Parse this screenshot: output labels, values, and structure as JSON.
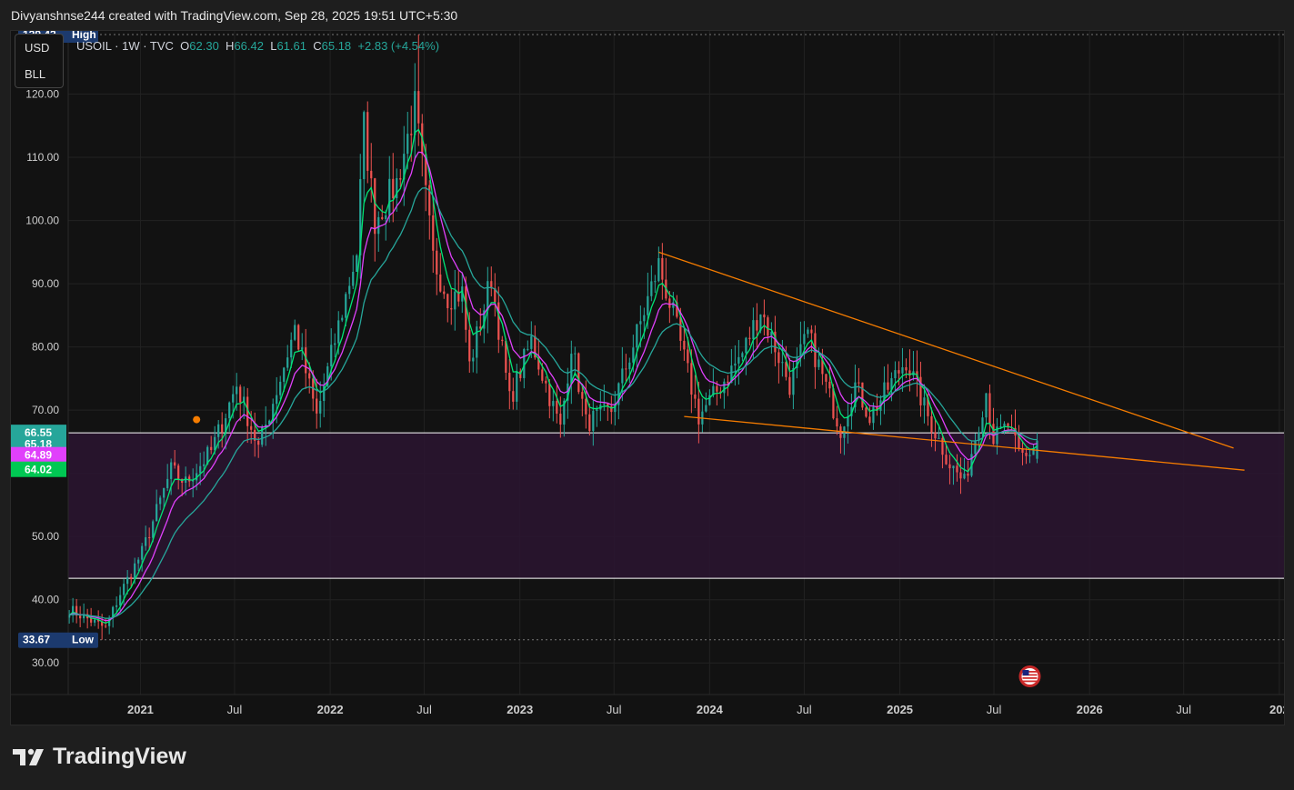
{
  "header": {
    "attribution": "Divyanshnse244 created with TradingView.com, Sep 28, 2025 19:51 UTC+5:30"
  },
  "unit_box": {
    "currency": "USD",
    "unit": "BLL"
  },
  "legend": {
    "symbol": "USOIL · 1W · TVC",
    "open_label": "O",
    "open": "62.30",
    "high_label": "H",
    "high": "66.42",
    "low_label": "L",
    "low": "61.61",
    "close_label": "C",
    "close": "65.18",
    "change": "+2.83 (+4.54%)"
  },
  "footer": {
    "brand": "TradingView",
    "logo_icon": "tradingview-logo-icon"
  },
  "colors": {
    "background": "#121212",
    "up": "#26a69a",
    "down": "#ef5350",
    "ma_fast": "#00e676",
    "ma_mid": "#e040fb",
    "ma_slow": "#26a69a",
    "trendline": "#f57c00",
    "zone": "#2a1530"
  },
  "chart_data": {
    "type": "candlestick",
    "timeframe": "1W",
    "symbol": "USOIL",
    "ylim": [
      25,
      130
    ],
    "xlim": [
      "2020-08-15",
      "2027-01-10"
    ],
    "y_ticks": [
      30,
      40,
      50,
      60,
      70,
      80,
      90,
      100,
      110,
      120
    ],
    "y_tick_labels": [
      "30.00",
      "40.00",
      "50.00",
      "60.00",
      "70.00",
      "80.00",
      "90.00",
      "100.00",
      "110.00",
      "120.00"
    ],
    "x_ticks": [
      {
        "date": "2021-01-01",
        "label": "2021",
        "bold": true
      },
      {
        "date": "2021-07-01",
        "label": "Jul",
        "bold": false
      },
      {
        "date": "2022-01-01",
        "label": "2022",
        "bold": true
      },
      {
        "date": "2022-07-01",
        "label": "Jul",
        "bold": false
      },
      {
        "date": "2023-01-01",
        "label": "2023",
        "bold": true
      },
      {
        "date": "2023-07-01",
        "label": "Jul",
        "bold": false
      },
      {
        "date": "2024-01-01",
        "label": "2024",
        "bold": true
      },
      {
        "date": "2024-07-01",
        "label": "Jul",
        "bold": false
      },
      {
        "date": "2025-01-01",
        "label": "2025",
        "bold": true
      },
      {
        "date": "2025-07-01",
        "label": "Jul",
        "bold": false
      },
      {
        "date": "2026-01-01",
        "label": "2026",
        "bold": true
      },
      {
        "date": "2026-07-01",
        "label": "Jul",
        "bold": false
      },
      {
        "date": "2027-01-01",
        "label": "202",
        "bold": true
      }
    ],
    "high_marker": {
      "value": 129.42,
      "label": "129.42",
      "tag": "High"
    },
    "low_marker": {
      "value": 33.67,
      "label": "33.67",
      "tag": "Low"
    },
    "price_tags": [
      {
        "value": 66.55,
        "label": "66.55",
        "color": "#26a69a"
      },
      {
        "value": 65.18,
        "label": "65.18",
        "color": "#26a69a"
      },
      {
        "value": 64.89,
        "label": "64.89",
        "color": "#e040fb"
      },
      {
        "value": 64.02,
        "label": "64.02",
        "color": "#00c853"
      }
    ],
    "zone": {
      "top": 66.4,
      "bottom": 43.4
    },
    "trendlines": [
      {
        "from": {
          "date": "2023-09-25",
          "price": 95.0
        },
        "to": {
          "date": "2026-10-05",
          "price": 64.0
        }
      },
      {
        "from": {
          "date": "2023-11-13",
          "price": 69.0
        },
        "to": {
          "date": "2026-10-26",
          "price": 60.5
        }
      }
    ],
    "marker_dot": {
      "date": "2021-04-19",
      "price": 68.5
    },
    "flag_icon": {
      "date": "2025-09-08",
      "name": "us-flag-icon"
    },
    "anchors": [
      [
        "2020-08-17",
        38.5
      ],
      [
        "2020-10-26",
        35.5
      ],
      [
        "2020-11-23",
        41.0
      ],
      [
        "2021-01-04",
        47.5
      ],
      [
        "2021-03-01",
        60.5
      ],
      [
        "2021-03-29",
        58.5
      ],
      [
        "2021-05-17",
        63.5
      ],
      [
        "2021-07-05",
        74.0
      ],
      [
        "2021-08-16",
        64.0
      ],
      [
        "2021-09-27",
        75.0
      ],
      [
        "2021-10-25",
        83.0
      ],
      [
        "2021-12-06",
        69.0
      ],
      [
        "2022-01-10",
        81.0
      ],
      [
        "2022-02-21",
        95.0
      ],
      [
        "2022-03-07",
        115.0
      ],
      [
        "2022-03-28",
        100.0
      ],
      [
        "2022-05-09",
        106.0
      ],
      [
        "2022-06-13",
        118.0
      ],
      [
        "2022-07-18",
        94.0
      ],
      [
        "2022-08-15",
        88.0
      ],
      [
        "2022-09-12",
        88.5
      ],
      [
        "2022-09-26",
        77.0
      ],
      [
        "2022-11-07",
        91.0
      ],
      [
        "2022-12-12",
        71.5
      ],
      [
        "2023-01-23",
        81.0
      ],
      [
        "2023-03-20",
        67.0
      ],
      [
        "2023-04-10",
        80.5
      ],
      [
        "2023-05-08",
        68.0
      ],
      [
        "2023-06-26",
        70.0
      ],
      [
        "2023-08-14",
        82.0
      ],
      [
        "2023-09-25",
        93.0
      ],
      [
        "2023-10-23",
        85.0
      ],
      [
        "2023-12-11",
        69.0
      ],
      [
        "2024-01-15",
        73.0
      ],
      [
        "2024-03-04",
        79.0
      ],
      [
        "2024-04-08",
        86.0
      ],
      [
        "2024-06-03",
        74.0
      ],
      [
        "2024-07-08",
        82.0
      ],
      [
        "2024-09-09",
        67.0
      ],
      [
        "2024-10-07",
        74.0
      ],
      [
        "2024-11-04",
        69.0
      ],
      [
        "2025-01-13",
        78.0
      ],
      [
        "2025-02-24",
        69.0
      ],
      [
        "2025-04-07",
        61.5
      ],
      [
        "2025-05-05",
        58.5
      ],
      [
        "2025-06-16",
        73.0
      ],
      [
        "2025-06-30",
        65.5
      ],
      [
        "2025-07-28",
        67.5
      ],
      [
        "2025-08-18",
        63.0
      ],
      [
        "2025-09-01",
        62.5
      ],
      [
        "2025-09-22",
        65.18
      ]
    ]
  }
}
